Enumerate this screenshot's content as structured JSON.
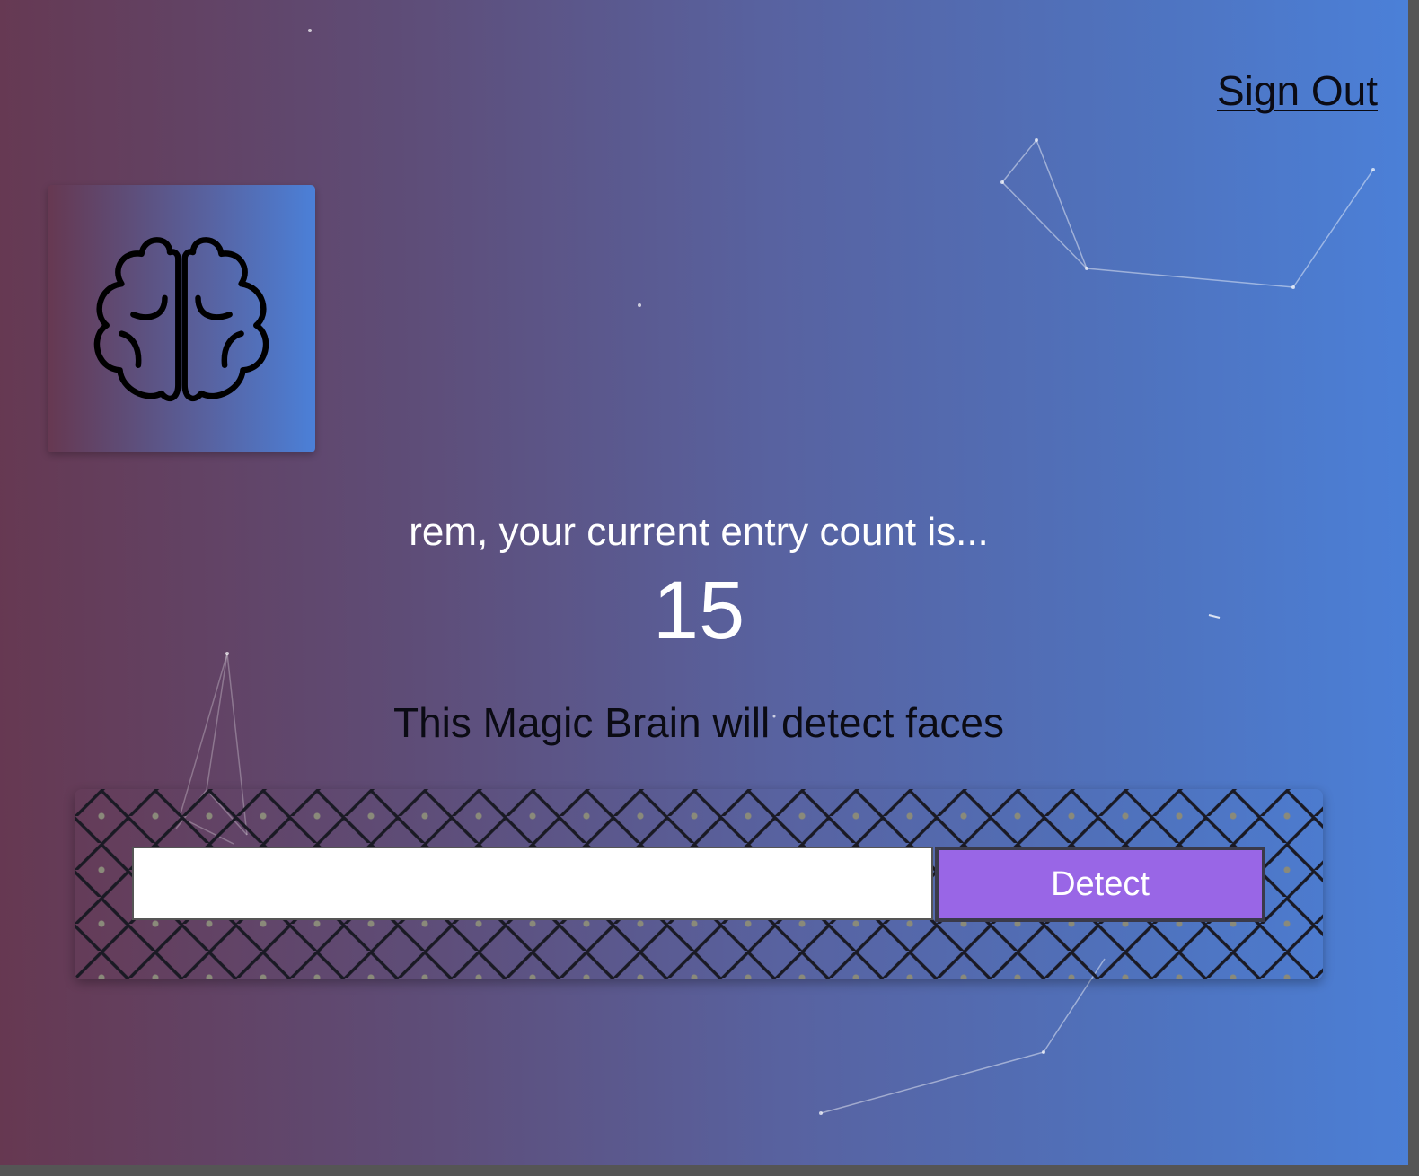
{
  "nav": {
    "sign_out_label": "Sign Out"
  },
  "logo": {
    "icon": "brain-icon"
  },
  "rank": {
    "message": "rem, your current entry count is...",
    "count": "15"
  },
  "image_link_form": {
    "tagline": "This Magic Brain will detect faces",
    "input_value": "",
    "input_placeholder": "",
    "detect_label": "Detect"
  },
  "colors": {
    "gradient_start": "#663851",
    "gradient_end": "#4b80d8",
    "detect_button": "#9966e6",
    "text_light": "#ffffff",
    "text_dark": "#0b0b14"
  }
}
